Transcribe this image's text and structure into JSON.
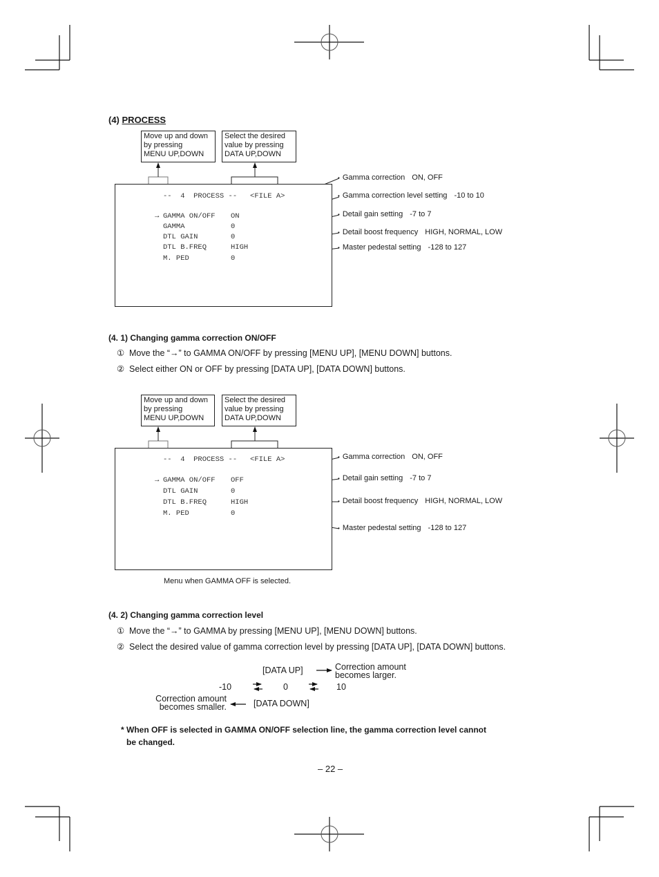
{
  "section": {
    "number": "(4)",
    "title": "PROCESS"
  },
  "callouts": {
    "menu": [
      "Move up and down",
      "by pressing",
      "MENU UP,DOWN"
    ],
    "data": [
      "Select the desired",
      "value by pressing",
      "DATA UP,DOWN"
    ]
  },
  "screen1": {
    "header": "--  4  PROCESS --   <FILE A>",
    "cursor": "→",
    "rows": [
      {
        "label": "GAMMA ON/OFF",
        "value": "ON"
      },
      {
        "label": "GAMMA",
        "value": "0"
      },
      {
        "label": "DTL GAIN",
        "value": "0"
      },
      {
        "label": "DTL B.FREQ",
        "value": "HIGH"
      },
      {
        "label": "M. PED",
        "value": "0"
      }
    ],
    "annotations": [
      {
        "name": "Gamma correction",
        "range": "ON, OFF"
      },
      {
        "name": "Gamma correction level setting",
        "range": "-10 to 10"
      },
      {
        "name": "Detail gain setting",
        "range": "-7 to 7"
      },
      {
        "name": "Detail boost frequency",
        "range": "HIGH, NORMAL, LOW"
      },
      {
        "name": "Master pedestal setting",
        "range": "-128 to 127"
      }
    ]
  },
  "sub1": {
    "number": "(4. 1)",
    "title": "Changing gamma correction ON/OFF",
    "steps": [
      {
        "num": "①",
        "text": "Move the “→” to GAMMA ON/OFF by pressing [MENU UP], [MENU DOWN] buttons."
      },
      {
        "num": "②",
        "text": "Select either ON or OFF by pressing [DATA UP], [DATA DOWN] buttons."
      }
    ]
  },
  "screen2": {
    "header": "--  4  PROCESS --   <FILE A>",
    "cursor": "→",
    "rows": [
      {
        "label": "GAMMA ON/OFF",
        "value": "OFF"
      },
      {
        "label": "DTL GAIN",
        "value": "0"
      },
      {
        "label": "DTL B.FREQ",
        "value": "HIGH"
      },
      {
        "label": "M. PED",
        "value": "0"
      }
    ],
    "annotations": [
      {
        "name": "Gamma correction",
        "range": "ON, OFF"
      },
      {
        "name": "Detail gain setting",
        "range": "-7 to 7"
      },
      {
        "name": "Detail boost frequency",
        "range": "HIGH, NORMAL, LOW"
      },
      {
        "name": "Master pedestal setting",
        "range": "-128 to 127"
      }
    ],
    "caption": "Menu when GAMMA OFF is selected."
  },
  "sub2": {
    "number": "(4. 2)",
    "title": "Changing gamma correction level",
    "steps": [
      {
        "num": "①",
        "text": "Move the “→” to GAMMA by pressing [MENU UP], [MENU DOWN] buttons."
      },
      {
        "num": "②",
        "text": "Select the desired value of gamma correction level by pressing [DATA UP], [DATA DOWN] buttons."
      }
    ]
  },
  "level_diagram": {
    "data_up": "[DATA UP]",
    "larger": [
      "Correction amount",
      "becomes larger."
    ],
    "min": "-10",
    "mid": "0",
    "max": "10",
    "data_down": "[DATA DOWN]",
    "smaller": [
      "Correction amount",
      "becomes smaller."
    ]
  },
  "note": [
    "* When OFF is selected in GAMMA ON/OFF selection line, the gamma correction level cannot",
    "be changed."
  ],
  "page_number": "– 22 –"
}
